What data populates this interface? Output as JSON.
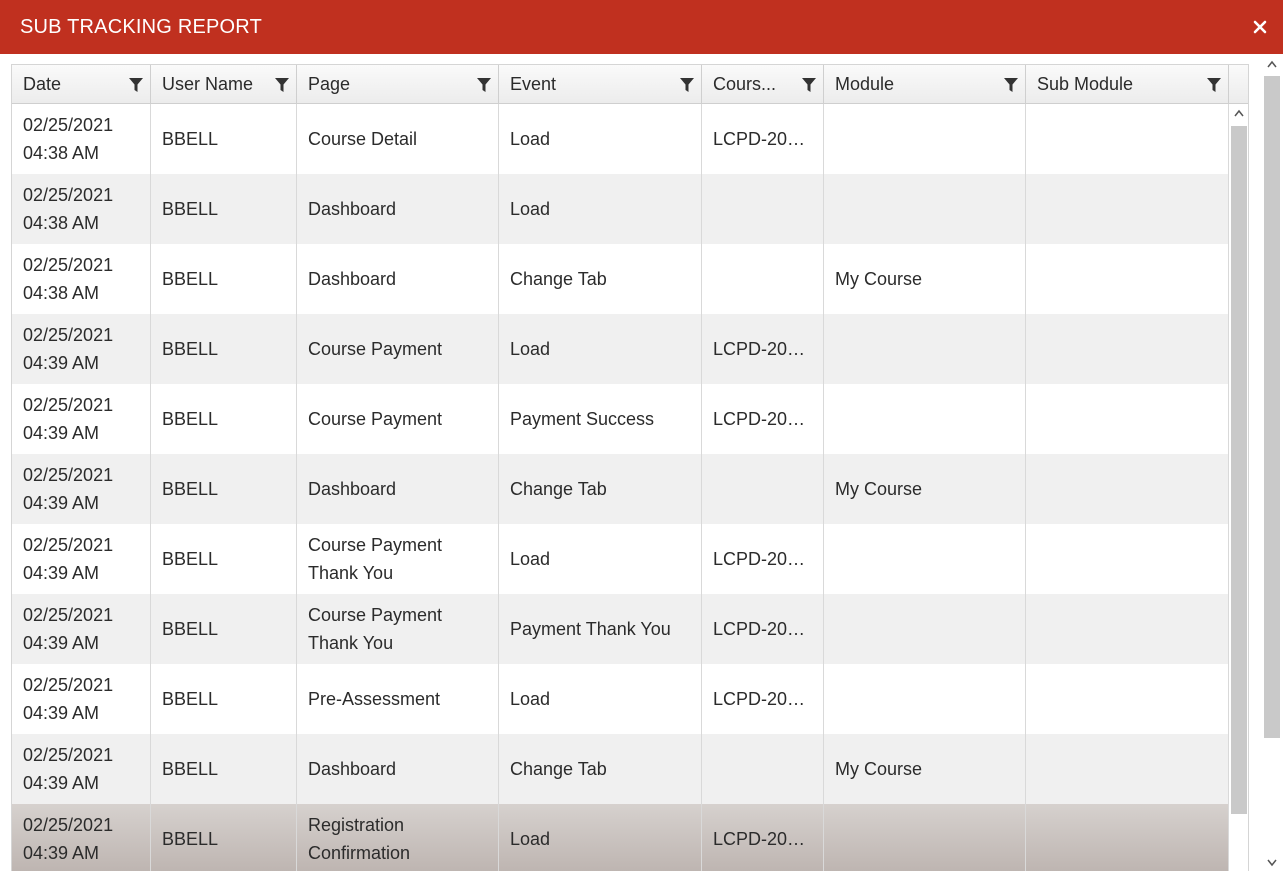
{
  "window": {
    "title": "SUB TRACKING REPORT",
    "close_icon": "close-icon",
    "title_bar_color": "#c0301f"
  },
  "grid": {
    "columns": [
      {
        "label": "Date",
        "icon": "filter-icon"
      },
      {
        "label": "User Name",
        "icon": "filter-icon"
      },
      {
        "label": "Page",
        "icon": "filter-icon"
      },
      {
        "label": "Event",
        "icon": "filter-icon"
      },
      {
        "label": "Cours...",
        "icon": "filter-icon"
      },
      {
        "label": "Module",
        "icon": "filter-icon"
      },
      {
        "label": "Sub Module",
        "icon": "filter-icon"
      }
    ],
    "rows": [
      {
        "date": "02/25/2021",
        "time": "04:38 AM",
        "user": "BBELL",
        "page": "Course Detail",
        "event": "Load",
        "course": "LCPD-2021...",
        "module": "",
        "sub_module": ""
      },
      {
        "date": "02/25/2021",
        "time": "04:38 AM",
        "user": "BBELL",
        "page": "Dashboard",
        "event": "Load",
        "course": "",
        "module": "",
        "sub_module": ""
      },
      {
        "date": "02/25/2021",
        "time": "04:38 AM",
        "user": "BBELL",
        "page": "Dashboard",
        "event": "Change Tab",
        "course": "",
        "module": "My Course",
        "sub_module": ""
      },
      {
        "date": "02/25/2021",
        "time": "04:39 AM",
        "user": "BBELL",
        "page": "Course Payment",
        "event": "Load",
        "course": "LCPD-2021...",
        "module": "",
        "sub_module": ""
      },
      {
        "date": "02/25/2021",
        "time": "04:39 AM",
        "user": "BBELL",
        "page": "Course Payment",
        "event": "Payment Success",
        "course": "LCPD-2021...",
        "module": "",
        "sub_module": ""
      },
      {
        "date": "02/25/2021",
        "time": "04:39 AM",
        "user": "BBELL",
        "page": "Dashboard",
        "event": "Change Tab",
        "course": "",
        "module": "My Course",
        "sub_module": ""
      },
      {
        "date": "02/25/2021",
        "time": "04:39 AM",
        "user": "BBELL",
        "page": "Course Payment Thank You",
        "event": "Load",
        "course": "LCPD-2021...",
        "module": "",
        "sub_module": ""
      },
      {
        "date": "02/25/2021",
        "time": "04:39 AM",
        "user": "BBELL",
        "page": "Course Payment Thank You",
        "event": "Payment Thank You",
        "course": "LCPD-2021...",
        "module": "",
        "sub_module": ""
      },
      {
        "date": "02/25/2021",
        "time": "04:39 AM",
        "user": "BBELL",
        "page": "Pre-Assessment",
        "event": "Load",
        "course": "LCPD-2021...",
        "module": "",
        "sub_module": ""
      },
      {
        "date": "02/25/2021",
        "time": "04:39 AM",
        "user": "BBELL",
        "page": "Dashboard",
        "event": "Change Tab",
        "course": "",
        "module": "My Course",
        "sub_module": ""
      },
      {
        "date": "02/25/2021",
        "time": "04:39 AM",
        "user": "BBELL",
        "page": "Registration Confirmation",
        "event": "Load",
        "course": "LCPD-2021...",
        "module": "",
        "sub_module": "",
        "selected": true
      }
    ]
  }
}
